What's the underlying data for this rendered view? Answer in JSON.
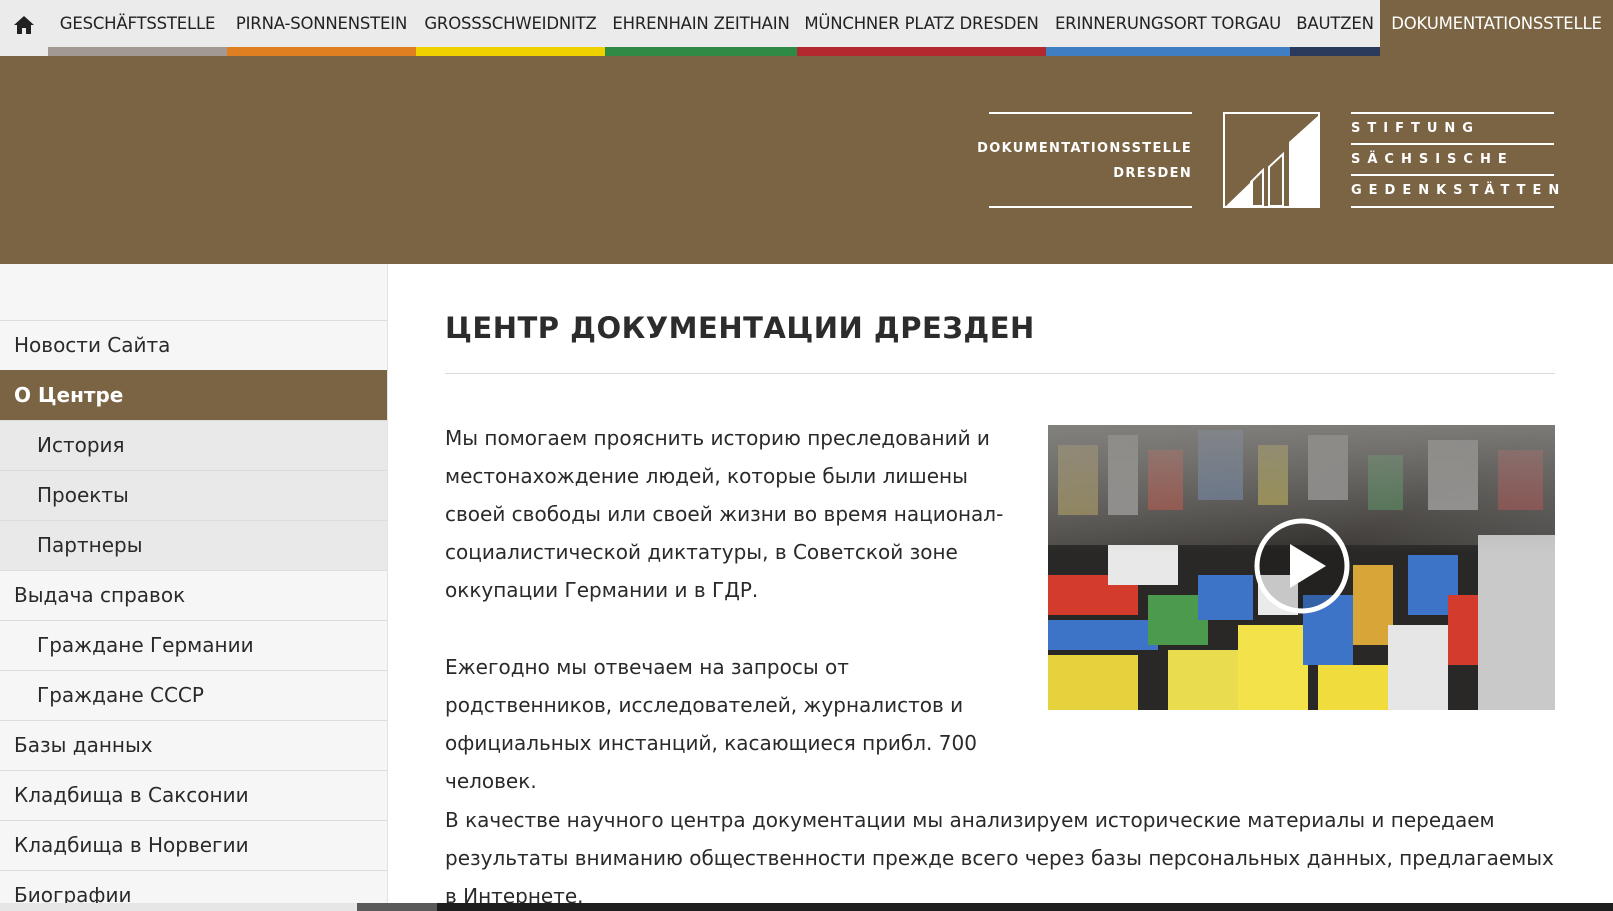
{
  "topnav": {
    "home_icon": "home-icon",
    "items": [
      {
        "label": "GESCHÄFTSSTELLE",
        "color": "#a09a93"
      },
      {
        "label": "PIRNA-SONNENSTEIN",
        "color": "#e07f22"
      },
      {
        "label": "GROSSSCHWEIDNITZ",
        "color": "#f0d100"
      },
      {
        "label": "EHRENHAIN ZEITHAIN",
        "color": "#2e8b45"
      },
      {
        "label": "MÜNCHNER PLATZ DRESDEN",
        "color": "#b3282e"
      },
      {
        "label": "ERINNERUNGSORT TORGAU",
        "color": "#3f7ec3"
      },
      {
        "label": "BAUTZEN",
        "color": "#2a3a5c"
      },
      {
        "label": "DOKUMENTATIONSSTELLE",
        "color": "#7a6444"
      }
    ],
    "active_index": 7
  },
  "header": {
    "bg_color": "#7a6444",
    "logo_left_line1": "DOKUMENTATIONSSTELLE",
    "logo_left_line2": "DRESDEN",
    "logo_right_line1": "STIFTUNG",
    "logo_right_line2": "SÄCHSISCHE",
    "logo_right_line3": "GEDENKSTÄTTEN"
  },
  "sidebar": {
    "items": [
      {
        "label": "Новости Сайта",
        "level": 0,
        "active": false
      },
      {
        "label": "О Центре",
        "level": 0,
        "active": true
      },
      {
        "label": "История",
        "level": 1,
        "active": false
      },
      {
        "label": "Проекты",
        "level": 1,
        "active": false
      },
      {
        "label": "Партнеры",
        "level": 1,
        "active": false
      },
      {
        "label": "Выдача справок",
        "level": 0,
        "active": false
      },
      {
        "label": "Граждане Германии",
        "level": 1,
        "active": false
      },
      {
        "label": "Граждане СССР",
        "level": 1,
        "active": false
      },
      {
        "label": "Базы данных",
        "level": 0,
        "active": false
      },
      {
        "label": "Кладбища в Саксонии",
        "level": 0,
        "active": false
      },
      {
        "label": "Кладбища в Норвегии",
        "level": 0,
        "active": false
      },
      {
        "label": "Биографии",
        "level": 0,
        "active": false
      }
    ]
  },
  "main": {
    "title": "ЦЕНТР ДОКУМЕНТАЦИИ ДРЕЗДЕН",
    "paragraph1": "Мы помогаем прояснить историю преследований и местонахождение людей, которые были лишены своей свободы или своей жизни во время национал-социалистической диктатуры, в Советской зоне оккупации Германии и в ГДР.",
    "paragraph2": "Ежегодно мы отвечаем на запросы от родственников, исследователей, журналистов и официальных инстанций, касающиеся прибл. 700 человек.",
    "paragraph3": "В качестве научного центра документации мы анализируем исторические материалы и передаем результаты вниманию общественности прежде всего через базы персональных данных, предлагаемых в Интернете.",
    "video": {
      "play_icon": "play-icon"
    }
  }
}
